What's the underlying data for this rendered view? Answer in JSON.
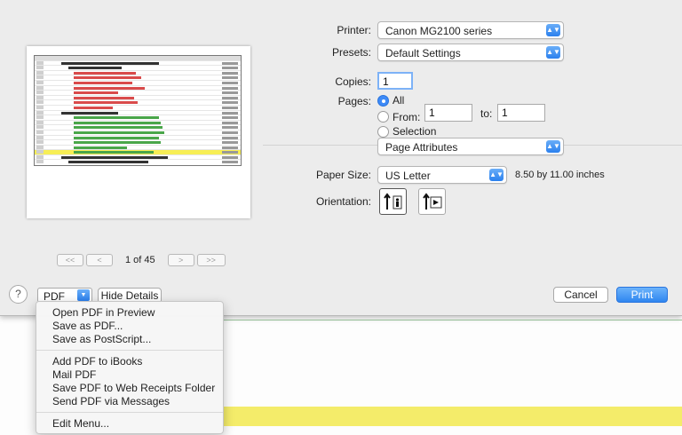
{
  "printer": {
    "label": "Printer:",
    "value": "Canon MG2100 series"
  },
  "presets": {
    "label": "Presets:",
    "value": "Default Settings"
  },
  "copies": {
    "label": "Copies:",
    "value": "1"
  },
  "pages": {
    "label": "Pages:",
    "all_label": "All",
    "from_label": "From:",
    "from_value": "1",
    "to_label": "to:",
    "to_value": "1",
    "selection_label": "Selection",
    "selected": "All"
  },
  "section_popup": {
    "value": "Page Attributes"
  },
  "paper_size": {
    "label": "Paper Size:",
    "value": "US Letter",
    "dimensions": "8.50 by 11.00 inches"
  },
  "orientation": {
    "label": "Orientation:",
    "selected": "portrait"
  },
  "preview": {
    "page_indicator": "1 of 45",
    "first_label": "<<",
    "prev_label": "<",
    "next_label": ">",
    "last_label": ">>"
  },
  "bottom_bar": {
    "help_label": "?",
    "pdf_label": "PDF",
    "hide_details_label": "Hide Details",
    "cancel_label": "Cancel",
    "print_label": "Print"
  },
  "pdf_menu": {
    "group1": [
      "Open PDF in Preview",
      "Save as PDF...",
      "Save as PostScript..."
    ],
    "group2": [
      "Add PDF to iBooks",
      "Mail PDF",
      "Save PDF to Web Receipts Folder",
      "Send PDF via Messages"
    ],
    "group3": [
      "Edit Menu..."
    ]
  },
  "colors": {
    "accent": "#2f86f0",
    "dialog_bg": "#ececec",
    "highlight_yellow": "#f4ec6a"
  }
}
